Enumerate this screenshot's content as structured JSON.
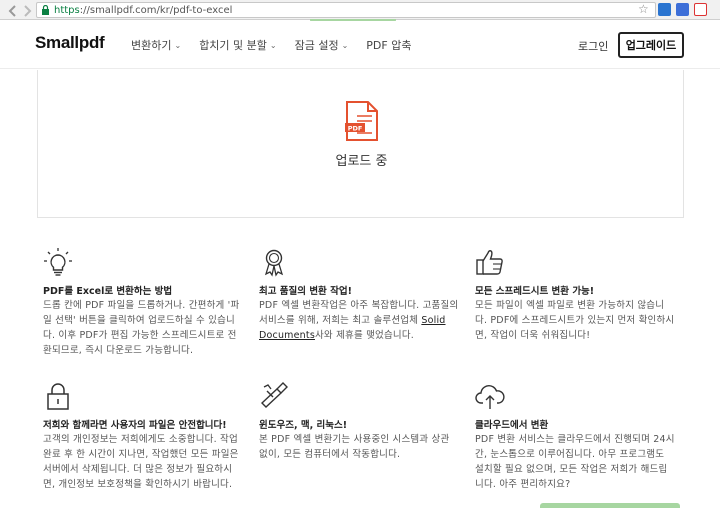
{
  "browser": {
    "url_scheme": "https",
    "url_rest": "://smallpdf.com/kr/pdf-to-excel"
  },
  "header": {
    "logo": "Smallpdf",
    "nav": [
      {
        "label": "변환하기",
        "has_dropdown": true
      },
      {
        "label": "합치기 및 분할",
        "has_dropdown": true
      },
      {
        "label": "잠금 설정",
        "has_dropdown": true
      },
      {
        "label": "PDF 압축",
        "has_dropdown": false
      }
    ],
    "login": "로그인",
    "upgrade": "업그레이드"
  },
  "upload": {
    "status": "업로드 중",
    "icon_badge": "PDF"
  },
  "features": [
    {
      "icon": "lightbulb-icon",
      "title": "PDF를 Excel로 변환하는 방법",
      "desc": "드롭 칸에 PDF 파일을 드롭하거나. 간편하게 '파일 선택' 버튼을 클릭하여 업로드하실 수 있습니다. 이후 PDF가 편집 가능한 스프레드시트로 전환되므로, 즉시 다운로드 가능합니다."
    },
    {
      "icon": "award-ribbon-icon",
      "title": "최고 품질의 변환 작업!",
      "desc_before": "PDF 엑셀 변환작업은 아주 복잡합니다. 고품질의 서비스를 위해, 저희는 최고 솔루션업체 ",
      "desc_link": "Solid Documents",
      "desc_after": "사와 제휴를 맺었습니다."
    },
    {
      "icon": "thumbs-up-icon",
      "title": "모든 스프레드시트 변환 가능!",
      "desc": "모든 파일이 엑셀 파일로 변환 가능하지 않습니다. PDF에 스프레드시트가 있는지 먼저 확인하시면, 작업이 더욱 쉬워집니다!"
    },
    {
      "icon": "padlock-icon",
      "title": "저희와 함께라면 사용자의 파일은 안전합니다!",
      "desc": "고객의 개인정보는 저희에게도 소중합니다. 작업 완료 후 한 시간이 지나면, 작업했던 모든 파일은 서버에서 삭제됩니다. 더 많은 정보가 필요하시면, 개인정보 보호정책을 확인하시기 바랍니다."
    },
    {
      "icon": "multi-tool-icon",
      "title": "윈도우즈, 맥, 리눅스!",
      "desc": "본 PDF 엑셀 변환기는 사용중인 시스템과 상관 없이, 모든 컴퓨터에서 작동합니다."
    },
    {
      "icon": "cloud-upload-icon",
      "title": "클라우드에서 변환",
      "desc": "PDF 변환 서비스는 클라우드에서 진행되며 24시간, 눈스톱으로 이루어집니다. 아무 프로그램도 설치할 필요 없으며, 모든 작업은 저희가 해드립니다. 아주 편리하지요?"
    }
  ],
  "colors": {
    "accent_red": "#e4512f",
    "url_green": "#0b8043",
    "progress_green": "#a7d6a1"
  }
}
